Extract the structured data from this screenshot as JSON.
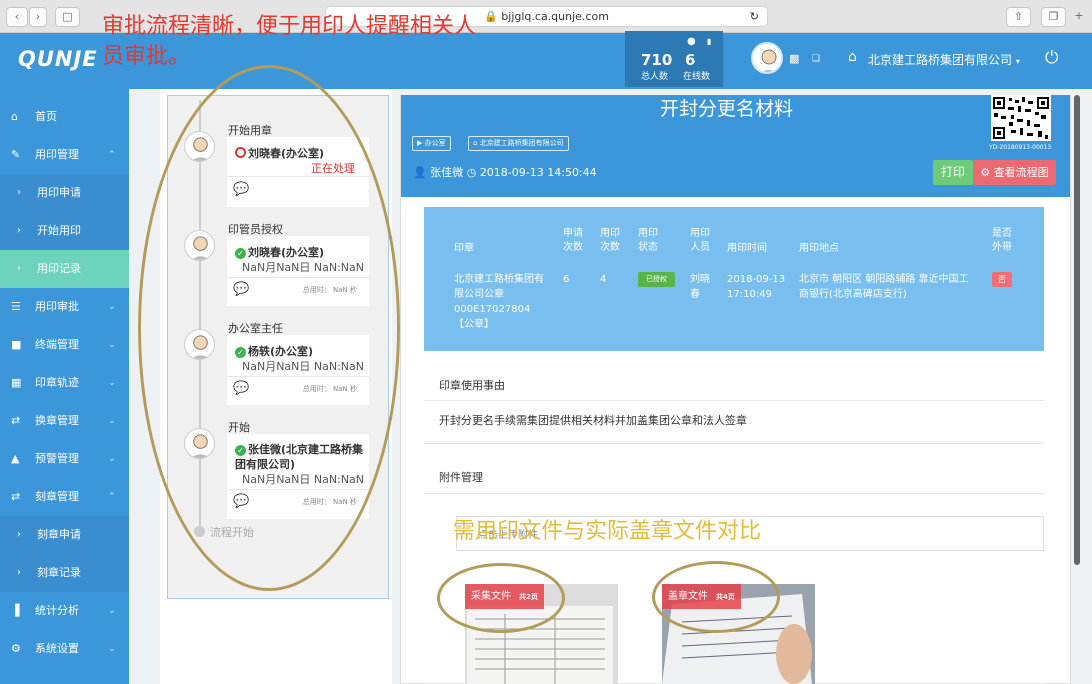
{
  "browser": {
    "url": "bjjglq.ca.qunje.com",
    "lock_icon": "lock-icon",
    "reload_icon": "reload-icon"
  },
  "header": {
    "logo": "QUNJE",
    "stats": {
      "total_num": "710",
      "total_label": "总人数",
      "online_num": "6",
      "online_label": "在线数"
    },
    "company": "北京建工路桥集团有限公司"
  },
  "sidebar": {
    "items": [
      {
        "label": "首页",
        "icon": "home-icon"
      },
      {
        "label": "用印管理",
        "icon": "edit-icon"
      },
      {
        "label": "用印申请",
        "icon": "chevron-right-icon"
      },
      {
        "label": "开始用印",
        "icon": "chevron-right-icon"
      },
      {
        "label": "用印记录",
        "icon": "chevron-right-icon"
      },
      {
        "label": "用印审批",
        "icon": "document-icon"
      },
      {
        "label": "终端管理",
        "icon": "folder-icon"
      },
      {
        "label": "印章轨迹",
        "icon": "map-icon"
      },
      {
        "label": "换章管理",
        "icon": "swap-icon"
      },
      {
        "label": "预警管理",
        "icon": "bell-icon"
      },
      {
        "label": "刻章管理",
        "icon": "swap-icon"
      },
      {
        "label": "刻章申请",
        "icon": "chevron-right-icon"
      },
      {
        "label": "刻章记录",
        "icon": "chevron-right-icon"
      },
      {
        "label": "统计分析",
        "icon": "bar-chart-icon"
      },
      {
        "label": "系统设置",
        "icon": "gear-icon"
      }
    ]
  },
  "flow": {
    "nodes": [
      {
        "title": "开始用章",
        "name": "刘晓春(办公室)",
        "status": "正在处理"
      },
      {
        "title": "印管员授权",
        "name": "刘晓春(办公室)",
        "time": "NaN月NaN日 NaN:NaN",
        "duration": "总用时： NaN 秒"
      },
      {
        "title": "办公室主任",
        "name": "杨轶(办公室)",
        "time": "NaN月NaN日 NaN:NaN",
        "duration": "总用时： NaN 秒"
      },
      {
        "title": "开始",
        "name": "张佳微(北京建工路桥集团有限公司)",
        "time": "NaN月NaN日 NaN:NaN",
        "duration": "总用时： NaN 秒"
      }
    ],
    "end_label": "流程开始"
  },
  "detail": {
    "title": "开封分更名材料",
    "tags": [
      "办公室",
      "北京建工路桥集团有限公司"
    ],
    "person": "张佳微",
    "datetime": "2018-09-13 14:50:44",
    "qr_code": "YD-20180913-00013",
    "print_label": "打印",
    "flow_label": "查看流程图",
    "table": {
      "headers": [
        "印章",
        "申请次数",
        "用印次数",
        "用印状态",
        "用印人员",
        "用印时间",
        "用印地点",
        "是否外带"
      ],
      "row": {
        "seal": "北京建工路桥集团有限公司公章000E17027804【公章】",
        "apply_count": "6",
        "use_count": "4",
        "status": "已授权",
        "user": "刘晓春",
        "time": "2018-09-13 17:10:49",
        "place": "北京市 朝阳区 朝阳路辅路 靠近中国工商银行(北京高碑店支行)",
        "external": "否"
      }
    },
    "reason_title": "印章使用事由",
    "reason_text": "开封分更名手续需集团提供相关材料并加盖集团公章和法人签章",
    "attach_title": "附件管理",
    "upload_label": "点击上传附件",
    "files": [
      {
        "label": "采集文件",
        "pages": "共2页"
      },
      {
        "label": "盖章文件",
        "pages": "共4页"
      }
    ]
  },
  "annotations": {
    "top": "审批流程清晰，便于用印人提醒相关人员审批。",
    "bottom": "需用印文件与实际盖章文件对比"
  },
  "colors": {
    "header": "#3c97da",
    "active": "#6dd3bd",
    "annotation_red": "#e8372f",
    "annotation_gold": "#e2bd3a"
  }
}
